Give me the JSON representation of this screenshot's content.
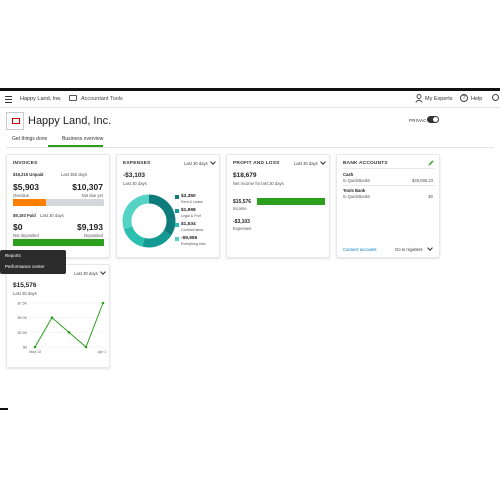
{
  "nav": {
    "company": "Happy Land, Inc.",
    "accountant_tools": "Accountant Tools",
    "my_experts": "My Experts",
    "help": "Help",
    "help_glyph": "?"
  },
  "header": {
    "title": "Happy Land, Inc.",
    "privacy": "PRIVACY"
  },
  "tabs": [
    "Get things done",
    "Business overview"
  ],
  "invoices": {
    "title": "INVOICES",
    "unpaid_amount": "$16,215 Unpaid",
    "unpaid_period": "Last 365 days",
    "overdue_value": "$5,903",
    "overdue_label": "Overdue",
    "notdue_value": "$10,307",
    "notdue_label": "Not due yet",
    "paid_amount": "$9,193 Paid",
    "paid_period": "Last 30 days",
    "notdep_value": "$0",
    "notdep_label": "Not deposited",
    "deposited_value": "$9,193",
    "deposited_label": "Deposited",
    "overdue_fraction": 0.36,
    "colors": {
      "overdue": "#ff8000",
      "notdue": "#d4d7dc",
      "deposited": "#2ca01c"
    }
  },
  "expenses": {
    "title": "EXPENSES",
    "period": "Last 30 days",
    "total": "-$3,103",
    "total_period": "Last 30 days",
    "items": [
      {
        "value": "$3,350",
        "label": "Rent & Lease",
        "color": "#0e7c7b"
      },
      {
        "value": "$1,998",
        "label": "Legal & Prof",
        "color": "#159a93"
      },
      {
        "value": "$1,534",
        "label": "Contract labor",
        "color": "#2bbfb0"
      },
      {
        "value": "-$9,955",
        "label": "Everything else",
        "color": "#55d3c4"
      }
    ],
    "donut": [
      34,
      20,
      16,
      30
    ]
  },
  "pnl": {
    "title": "PROFIT AND LOSS",
    "period": "Last 30 days",
    "net": "$18,679",
    "net_label": "Net income for last 30 days",
    "income_value": "$15,576",
    "income_label": "Income",
    "expenses_value": "-$3,103",
    "expenses_label": "Expenses",
    "income_color": "#2ca01c"
  },
  "bank": {
    "title": "BANK ACCOUNTS",
    "accounts": [
      {
        "name": "Cash",
        "sub": "In QuickBooks",
        "amount": "$49,095.23"
      },
      {
        "name": "Tools Bank",
        "sub": "In QuickBooks",
        "amount": "$0"
      }
    ],
    "connect": "Connect accounts",
    "register": "Go to registers"
  },
  "popup": {
    "items": [
      "Reports",
      "Performance center"
    ]
  },
  "sales": {
    "period": "Last 30 days",
    "total": "$15,576",
    "total_period": "Last 30 days",
    "yticks": [
      "$7.5K",
      "$5.0K",
      "$2.5K",
      "$0"
    ],
    "xticks": [
      "May 18",
      "Apr 17"
    ]
  },
  "chart_data": {
    "type": "line",
    "x": [
      1,
      2,
      3,
      4,
      5
    ],
    "values": [
      0,
      5000,
      2500,
      0,
      7500
    ],
    "ylim": [
      0,
      7500
    ],
    "yticks": [
      "$7.5K",
      "$5.0K",
      "$2.5K",
      "$0"
    ],
    "xticks": [
      "May 18",
      "Apr 17"
    ],
    "color": "#2ca01c"
  }
}
